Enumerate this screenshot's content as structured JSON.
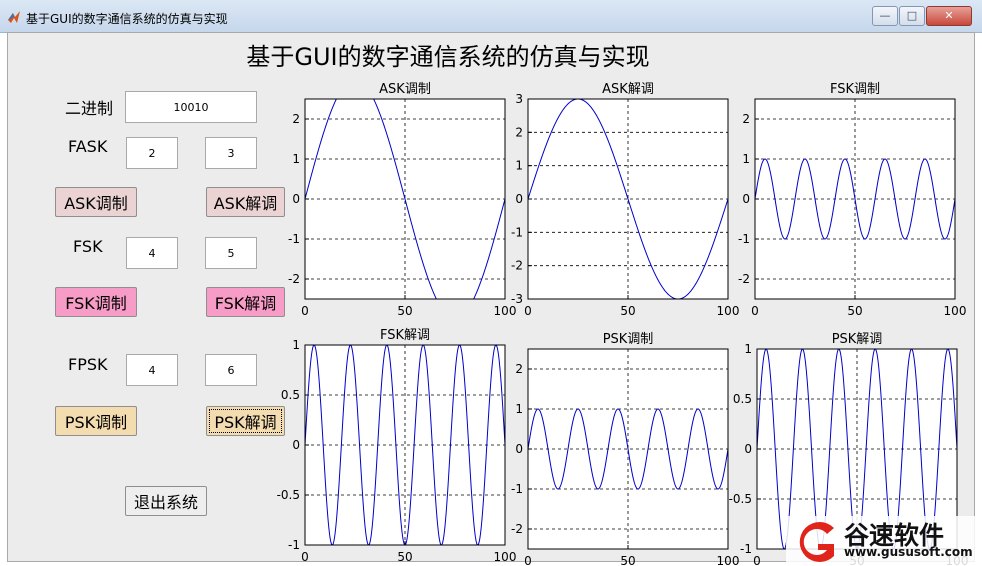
{
  "window": {
    "title": "基于GUI的数字通信系统的仿真与实现",
    "controls": {
      "minimize": "—",
      "maximize": "□",
      "close": "✕"
    }
  },
  "figure": {
    "title": "基于GUI的数字通信系统的仿真与实现"
  },
  "form": {
    "binary_label": "二进制",
    "binary_value": "10010",
    "fask_label": "FASK",
    "fask_values": [
      "2",
      "3"
    ],
    "ask_mod_button": "ASK调制",
    "ask_demod_button": "ASK解调",
    "fsk_label": "FSK",
    "fsk_values": [
      "4",
      "5"
    ],
    "fsk_mod_button": "FSK调制",
    "fsk_demod_button": "FSK解调",
    "fpsk_label": "FPSK",
    "fpsk_values": [
      "4",
      "6"
    ],
    "psk_mod_button": "PSK调制",
    "psk_demod_button": "PSK解调",
    "exit_button": "退出系统"
  },
  "colors": {
    "curve": "#0000cc",
    "ask_button": "#ebd3d3",
    "fsk_button": "#f79cc6",
    "psk_button": "#f3dcb0"
  },
  "watermark": {
    "brand": "谷速软件",
    "url": "www.gususoft.com",
    "logo": "g-logo-icon"
  },
  "chart_data": [
    {
      "type": "line",
      "title": "ASK调制",
      "xlim": [
        0,
        100
      ],
      "ylim": [
        -2.5,
        2.5
      ],
      "xticks": [
        "0",
        "50",
        "100"
      ],
      "yticks": [
        "-2",
        "-1",
        "0",
        "1",
        "2"
      ],
      "grid": true,
      "series": [
        {
          "function": "3*sin(2*pi*x/100)",
          "x_range": [
            0,
            100
          ]
        }
      ]
    },
    {
      "type": "line",
      "title": "ASK解调",
      "xlim": [
        0,
        100
      ],
      "ylim": [
        -3,
        3
      ],
      "xticks": [
        "0",
        "50",
        "100"
      ],
      "yticks": [
        "-3",
        "-2",
        "-1",
        "0",
        "1",
        "2",
        "3"
      ],
      "grid": true,
      "series": [
        {
          "function": "3*sin(2*pi*x/100)",
          "x_range": [
            0,
            100
          ]
        }
      ]
    },
    {
      "type": "line",
      "title": "FSK调制",
      "xlim": [
        0,
        100
      ],
      "ylim": [
        -2.5,
        2.5
      ],
      "xticks": [
        "0",
        "50",
        "100"
      ],
      "yticks": [
        "-2",
        "-1",
        "0",
        "1",
        "2"
      ],
      "grid": true,
      "series": [
        {
          "function": "sin(2*pi*5*x/100)",
          "x_range": [
            0,
            100
          ]
        }
      ]
    },
    {
      "type": "line",
      "title": "FSK解调",
      "xlim": [
        0,
        100
      ],
      "ylim": [
        -1,
        1
      ],
      "xticks": [
        "0",
        "50",
        "100"
      ],
      "yticks": [
        "-1",
        "-0.5",
        "0",
        "0.5",
        "1"
      ],
      "grid": true,
      "series": [
        {
          "function": "sin(2*pi*5.5*x/100)",
          "x_range": [
            0,
            100
          ]
        }
      ]
    },
    {
      "type": "line",
      "title": "PSK调制",
      "xlim": [
        0,
        100
      ],
      "ylim": [
        -2.5,
        2.5
      ],
      "xticks": [
        "0",
        "50",
        "100"
      ],
      "yticks": [
        "-2",
        "-1",
        "0",
        "1",
        "2"
      ],
      "grid": true,
      "series": [
        {
          "function": "sin(2*pi*5*x/100)",
          "x_range": [
            0,
            100
          ]
        }
      ]
    },
    {
      "type": "line",
      "title": "PSK解调",
      "xlim": [
        0,
        100
      ],
      "ylim": [
        -1,
        1
      ],
      "xticks": [
        "0",
        "50",
        "100"
      ],
      "yticks": [
        "-1",
        "-0.5",
        "0",
        "0.5",
        "1"
      ],
      "grid": true,
      "series": [
        {
          "function": "sin(2*pi*5.5*x/100)",
          "x_range": [
            0,
            100
          ]
        }
      ]
    }
  ]
}
